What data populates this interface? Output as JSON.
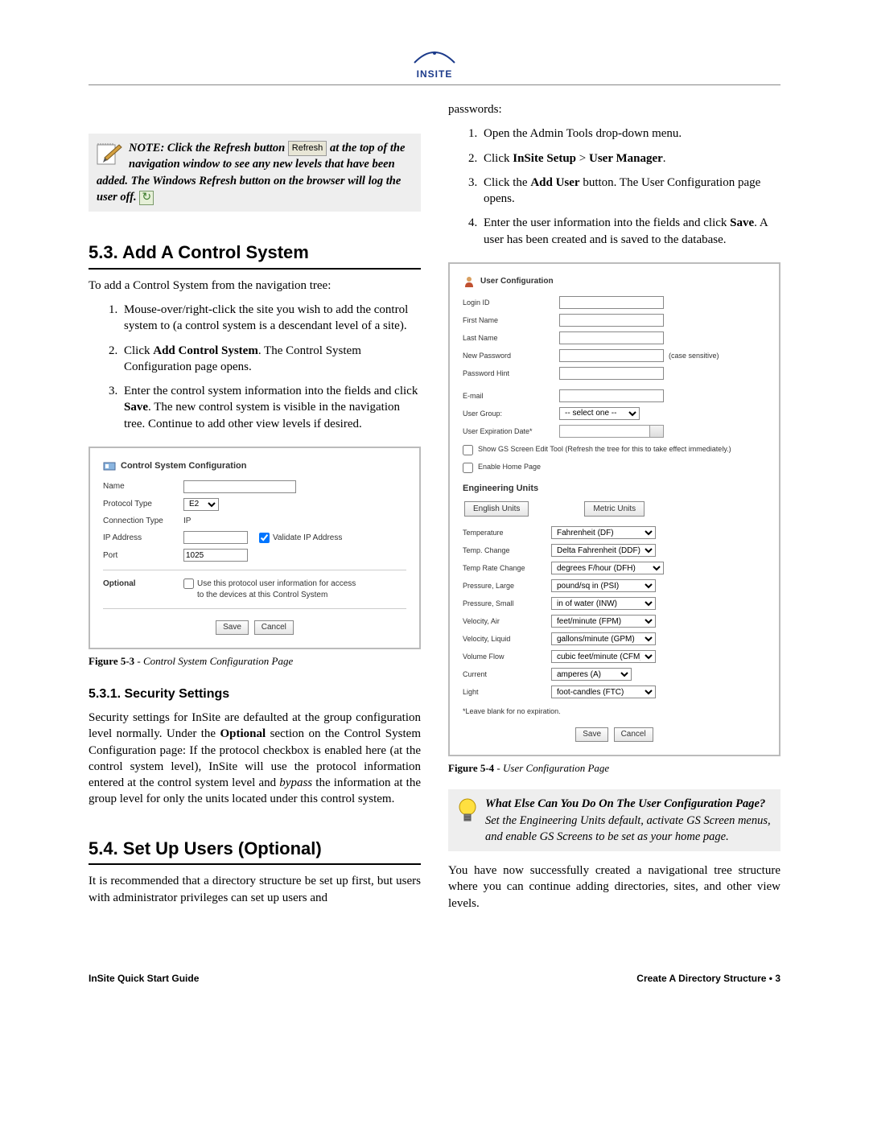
{
  "logo": "INSITE",
  "note_box": {
    "prefix": "NOTE: Click the Refresh button ",
    "button_label": "Refresh",
    "mid": " at the top of the navigation window to see any new levels that have been added. The Windows Refresh button on the browser will log the user off. "
  },
  "sec53": {
    "heading": "5.3.    Add A Control System",
    "intro": "To add a Control System from the navigation tree:",
    "steps": [
      "Mouse-over/right-click the site you wish to add the control system to (a control system is a descendant level of a site).",
      "Click Add Control System. The Control System Configuration page opens.",
      "Enter the control system information into the fields and click Save. The new control system is visible in the navigation tree. Continue to add other view levels if desired."
    ]
  },
  "fig53": {
    "title": "Control System Configuration",
    "fields": {
      "name": "Name",
      "protocol_type": "Protocol Type",
      "protocol_value": "E2",
      "connection_type": "Connection Type",
      "connection_value": "IP",
      "ip_address": "IP Address",
      "validate": "Validate IP Address",
      "port": "Port",
      "port_value": "1025",
      "optional": "Optional",
      "optional_text": "Use this protocol user information for access to the devices at this Control System",
      "save": "Save",
      "cancel": "Cancel"
    },
    "caption_label": "Figure 5-3",
    "caption_text": " - Control System Configuration Page"
  },
  "sec531": {
    "heading": "5.3.1.   Security Settings",
    "body": "Security settings for InSite are defaulted at the group configuration level normally. Under the Optional section on the Control System Configuration page: If the protocol checkbox is enabled here (at the control system level), InSite will use the protocol information entered at the control system level and bypass the information at the group level for only the units located under this control system."
  },
  "sec54": {
    "heading": "5.4.    Set Up Users (Optional)",
    "intro": "It is recommended that a directory structure be set up first, but users with administrator privileges can set up users and"
  },
  "right": {
    "passwords": "passwords:",
    "steps": [
      "Open the Admin Tools drop-down menu.",
      "Click InSite Setup > User Manager.",
      "Click the Add User button. The User Configuration page opens.",
      "Enter the user information into the fields and click Save. A user has been created and is saved to the database."
    ]
  },
  "fig54": {
    "title": "User Configuration",
    "labels": {
      "login_id": "Login ID",
      "first_name": "First Name",
      "last_name": "Last Name",
      "new_password": "New Password",
      "case": "(case sensitive)",
      "password_hint": "Password Hint",
      "email": "E-mail",
      "user_group": "User Group:",
      "user_group_value": "-- select one --",
      "user_exp": "User Expiration Date*",
      "show_gs": "Show GS Screen Edit Tool (Refresh the tree for this to take effect immediately.)",
      "enable_home": "Enable Home Page",
      "eng_units": "Engineering Units",
      "english": "English Units",
      "metric": "Metric Units",
      "temperature": "Temperature",
      "temp_change": "Temp. Change",
      "temp_rate": "Temp Rate Change",
      "pressure_large": "Pressure, Large",
      "pressure_small": "Pressure, Small",
      "velocity_air": "Velocity, Air",
      "velocity_liquid": "Velocity, Liquid",
      "volume_flow": "Volume Flow",
      "current": "Current",
      "light": "Light",
      "footnote": "*Leave blank for no expiration.",
      "save": "Save",
      "cancel": "Cancel"
    },
    "unit_values": {
      "temperature": "Fahrenheit (DF)",
      "temp_change": "Delta Fahrenheit (DDF)",
      "temp_rate": "degrees F/hour (DFH)",
      "pressure_large": "pound/sq in (PSI)",
      "pressure_small": "in of water (INW)",
      "velocity_air": "feet/minute (FPM)",
      "velocity_liquid": "gallons/minute (GPM)",
      "volume_flow": "cubic feet/minute (CFM)",
      "current": "amperes (A)",
      "light": "foot-candles (FTC)"
    },
    "caption_label": "Figure 5-4",
    "caption_text": " - User Configuration Page"
  },
  "tip": {
    "bold": "What Else Can You Do On The User Configuration Page? ",
    "rest": "Set the Engineering Units default, activate GS Screen menus, and enable GS Screens to be set as your home page."
  },
  "closing": "You have now successfully created a navigational tree structure where you can continue adding directories, sites, and other view levels.",
  "footer": {
    "left": "InSite Quick Start Guide",
    "right": "Create A Directory Structure • 3"
  }
}
